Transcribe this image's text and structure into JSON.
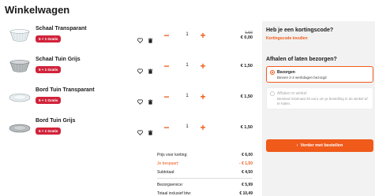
{
  "page": {
    "title": "Winkelwagen"
  },
  "items": [
    {
      "name": "Schaal Transparant",
      "badge": "5 + 1 Gratis",
      "qty": "1",
      "price_old": "1,50",
      "price": "€ 0,00",
      "image": "glass-bowl"
    },
    {
      "name": "Schaal Tuin Grijs",
      "badge": "5 + 1 Gratis",
      "qty": "1",
      "price": "€ 1,50",
      "image": "grey-bowl"
    },
    {
      "name": "Bord Tuin Transparant",
      "badge": "5 + 1 Gratis",
      "qty": "1",
      "price": "€ 1,50",
      "image": "glass-plate"
    },
    {
      "name": "Bord Tuin Grijs",
      "badge": "5 + 1 Gratis",
      "qty": "1",
      "price": "€ 1,50",
      "image": "grey-plate"
    }
  ],
  "summary": {
    "price_before_discount_label": "Prijs voor korting:",
    "price_before_discount": "€ 6,00",
    "saved_label": "Je bespaart:",
    "saved": "- € 1,50",
    "subtotal_label": "Subtotaal:",
    "subtotal": "€ 4,50",
    "shipping_label": "Bezorgservice:",
    "shipping": "€ 5,99",
    "total_label": "Totaal inclusief btw:",
    "total": "€ 10,49"
  },
  "sidebar": {
    "coupon_heading": "Heb je een kortingscode?",
    "coupon_link": "Kortingscode invullen",
    "delivery_heading": "Afhalen of laten bezorgen?",
    "options": [
      {
        "title": "Bezorgen",
        "sub": "Binnen 2-3 werkdagen bezorgd",
        "selected": true
      },
      {
        "title": "Afhalen in winkel",
        "sub": "Besteed minimaal 20 euro om je bestelling in de winkel af te halen.",
        "selected": false
      }
    ],
    "checkout_label": "Verder met bestellen"
  },
  "colors": {
    "accent": "#f05a1a",
    "badge": "#d1233a",
    "sidebar_bg": "#f2f2f2"
  }
}
